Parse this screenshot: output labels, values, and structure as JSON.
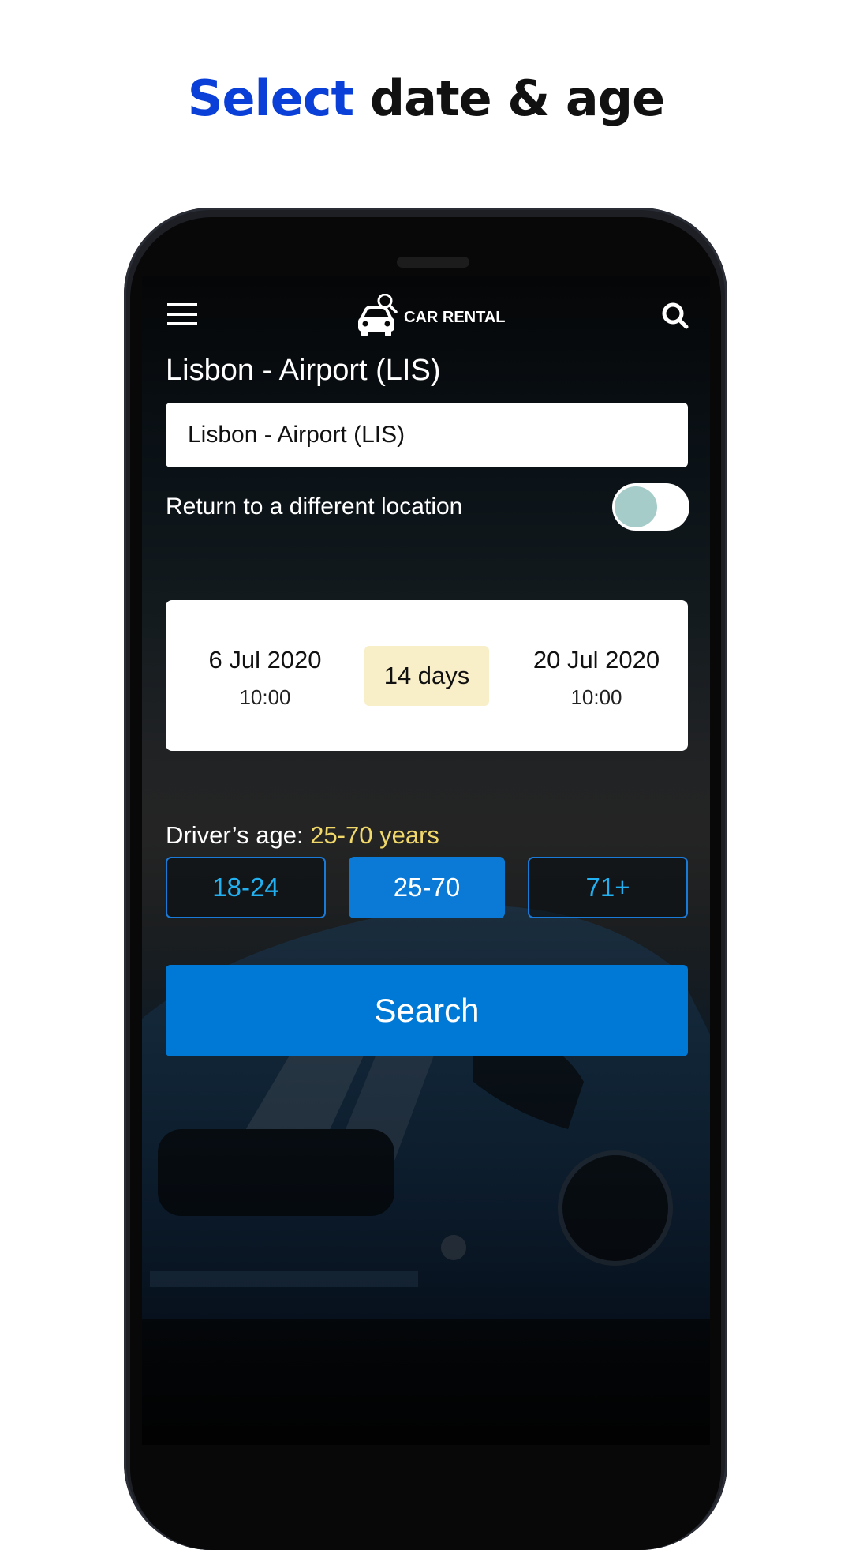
{
  "headline": {
    "accent": "Select",
    "rest": " date & age",
    "accent_color": "#0a3fd8"
  },
  "topbar": {
    "menu_icon": "hamburger-menu-icon",
    "logo_icon": "car-search-icon",
    "logo_text": "CAR RENTAL",
    "search_icon": "search-icon"
  },
  "location": {
    "title": "Lisbon - Airport (LIS)",
    "input_value": "Lisbon - Airport (LIS)"
  },
  "return_toggle": {
    "label": "Return to a different location",
    "enabled": false
  },
  "dates": {
    "pickup_date": "6 Jul 2020",
    "pickup_time": "10:00",
    "duration": "14 days",
    "return_date": "20 Jul 2020",
    "return_time": "10:00"
  },
  "driver_age": {
    "label": "Driver’s age: ",
    "value": "25-70 years",
    "options": [
      {
        "label": "18-24",
        "selected": false
      },
      {
        "label": "25-70",
        "selected": true
      },
      {
        "label": "71+",
        "selected": false
      }
    ]
  },
  "search_button": {
    "label": "Search",
    "color": "#0079d6"
  }
}
